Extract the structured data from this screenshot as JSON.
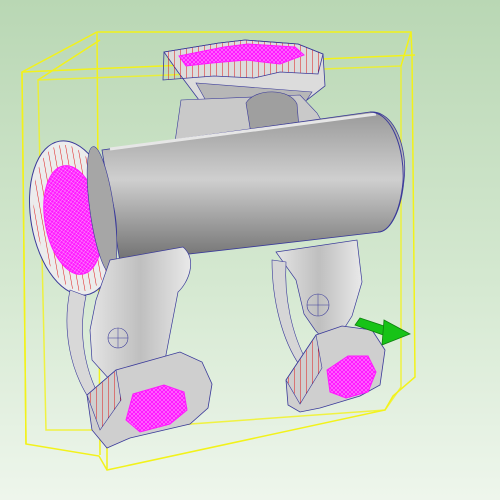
{
  "viewport": {
    "background_top": "#b9d7b4",
    "background_bottom": "#eef6ec"
  },
  "colors": {
    "bounding_box": "#f2f21a",
    "part_body": "#8f8f8f",
    "part_highlight": "#d6d6d6",
    "mesh_edges": "#3a3a9a",
    "selected_face": "#ff1aff",
    "hatch_lines": "#e01818",
    "direction_arrow": "#17c317"
  },
  "icons": {
    "direction_arrow": "green-direction-arrow-icon"
  },
  "model": {
    "part_type": "cast manifold with flanged inlet, top pad and two legs",
    "selected_faces": [
      "top-pad-face",
      "left-flange-face",
      "left-leg-foot-face",
      "right-leg-foot-face"
    ]
  }
}
